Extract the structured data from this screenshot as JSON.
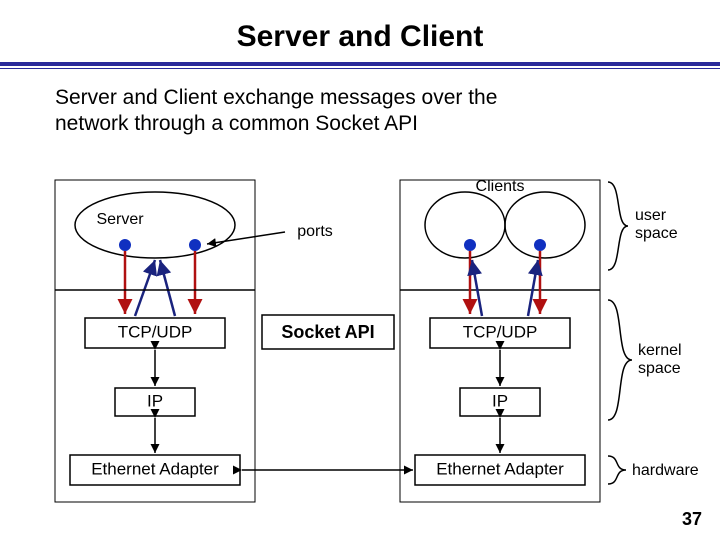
{
  "title": "Server and Client",
  "subtitle": "Server and Client exchange messages over the network through a common Socket API",
  "page_number": "37",
  "labels": {
    "server": "Server",
    "clients": "Clients",
    "ports": "ports",
    "socket_api": "Socket API",
    "tcp_udp_left": "TCP/UDP",
    "tcp_udp_right": "TCP/UDP",
    "ip_left": "IP",
    "ip_right": "IP",
    "eth_left": "Ethernet Adapter",
    "eth_right": "Ethernet Adapter",
    "user_space": "user\nspace",
    "kernel_space": "kernel\nspace",
    "hardware": "hardware"
  },
  "colors": {
    "arrow_red": "#b01010",
    "arrow_navy": "#1a237e",
    "title_blue": "#2a2a9a",
    "port_blue": "#1030c0"
  }
}
